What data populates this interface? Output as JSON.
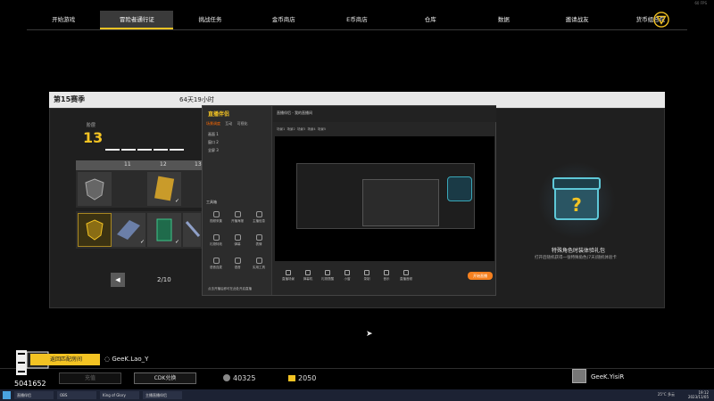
{
  "status": {
    "fps": "60 FPS"
  },
  "nav": {
    "tabs": [
      {
        "label": "开始游戏"
      },
      {
        "label": "冒险者通行证",
        "active": true
      },
      {
        "label": "挑战任务"
      },
      {
        "label": "金币商店"
      },
      {
        "label": "E币商店"
      },
      {
        "label": "仓库"
      },
      {
        "label": "数据"
      },
      {
        "label": "邀请战友"
      },
      {
        "label": "货币组合包"
      }
    ],
    "logo_icon": "triangle-logo-icon"
  },
  "season": {
    "title": "第15赛季",
    "timer": "64天19小时",
    "level_label": "阶层",
    "level": "13",
    "columns": [
      "11",
      "12",
      "13"
    ],
    "page": "2/10"
  },
  "obs": {
    "brand": "直播伴侣",
    "tabs": [
      "场景调度",
      "互动",
      "可视化"
    ],
    "sources": [
      "画面 1",
      "窗口 2",
      "全屏 3"
    ],
    "tools_label": "工具箱",
    "title": "直播伴侣 - 我的直播间",
    "scene_tabs": [
      "场景1",
      "场景2",
      "场景3",
      "场景4",
      "场景5"
    ],
    "tools": [
      "视频采集",
      "开播海报",
      "主播信息",
      "礼物特效",
      "弹幕",
      "表情",
      "语音连麦",
      "语音",
      "实用工具"
    ],
    "controls": [
      "直播场景",
      "弹幕机",
      "礼物提醒",
      "小窗",
      "录制",
      "音乐",
      "直播音频"
    ],
    "tip": "点击开播后即可在此处开启直播",
    "live_button": "开始直播"
  },
  "reward": {
    "title": "特殊角色时装体验礼包",
    "subtitle": "打开后随机获得一张特殊角色(7天)随机体验卡"
  },
  "bottom": {
    "badge_text": "EG",
    "user_id": "5041652",
    "team_button": "返回匹配房间",
    "player_left": "GeeK.Lao_Y",
    "dim_button": "充值",
    "cdk_button": "CDK兑换",
    "coins": "40325",
    "ecoins": "2050",
    "player_right": "GeeK.YisiR"
  },
  "taskbar": {
    "items": [
      "直播伴侣",
      "OBS",
      "King of Glory",
      "主播直播伴侣"
    ],
    "tray": "25°C 多云",
    "time": "19:12",
    "date": "2023/11/05"
  }
}
